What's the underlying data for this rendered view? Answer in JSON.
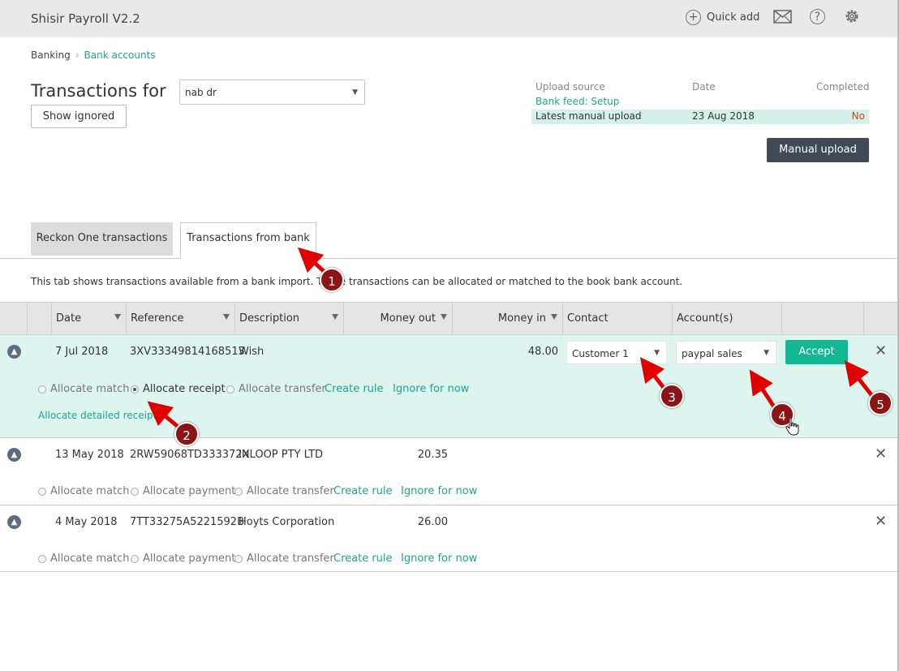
{
  "app": {
    "title": "Shisir Payroll V2.2",
    "quick_add": "Quick add"
  },
  "breadcrumb": {
    "root": "Banking",
    "current": "Bank accounts"
  },
  "page": {
    "title": "Transactions for",
    "account_value": "nab dr",
    "show_ignored": "Show ignored"
  },
  "upload": {
    "headers": {
      "source": "Upload source",
      "date": "Date",
      "completed": "Completed"
    },
    "bank_feed": "Bank feed: Setup",
    "latest_label": "Latest manual upload",
    "latest_date": "23 Aug 2018",
    "latest_completed": "No",
    "manual_button": "Manual upload"
  },
  "tabs": {
    "reckon": "Reckon One transactions",
    "bank": "Transactions from bank"
  },
  "tab_description": "This tab shows transactions available from a bank import. These transactions can be allocated or matched to the book bank account.",
  "columns": {
    "date": "Date",
    "reference": "Reference",
    "description": "Description",
    "money_out": "Money out",
    "money_in": "Money in",
    "contact": "Contact",
    "accounts": "Account(s)"
  },
  "rows": [
    {
      "date": "7 Jul 2018",
      "reference": "3XV33349814168513",
      "description": "Wish",
      "money_out": "",
      "money_in": "48.00",
      "contact": "Customer 1",
      "account": "paypal sales",
      "accept": "Accept",
      "options": [
        "Allocate match",
        "Allocate receipt",
        "Allocate transfer"
      ],
      "create_rule": "Create rule",
      "ignore": "Ignore for now",
      "detailed": "Allocate detailed receipt"
    },
    {
      "date": "13 May 2018",
      "reference": "2RW59068TD333372X",
      "description": "INLOOP PTY LTD",
      "money_out": "20.35",
      "money_in": "",
      "options": [
        "Allocate match",
        "Allocate payment",
        "Allocate transfer"
      ],
      "create_rule": "Create rule",
      "ignore": "Ignore for now"
    },
    {
      "date": "4 May 2018",
      "reference": "7TT33275A5221592B",
      "description": "Hoyts Corporation",
      "money_out": "26.00",
      "money_in": "",
      "options": [
        "Allocate match",
        "Allocate payment",
        "Allocate transfer"
      ],
      "create_rule": "Create rule",
      "ignore": "Ignore for now"
    }
  ],
  "callouts": [
    "1",
    "2",
    "3",
    "4",
    "5"
  ],
  "colors": {
    "accent": "#12b894",
    "link": "#1aa58c",
    "selected_row": "#def5ef",
    "dark_button": "#3f4a55",
    "callout": "#8b1414"
  },
  "icons": [
    "plus-circle-icon",
    "mail-icon",
    "help-icon",
    "gear-icon",
    "chevron-up-icon",
    "close-icon",
    "pointer-hand-icon"
  ]
}
